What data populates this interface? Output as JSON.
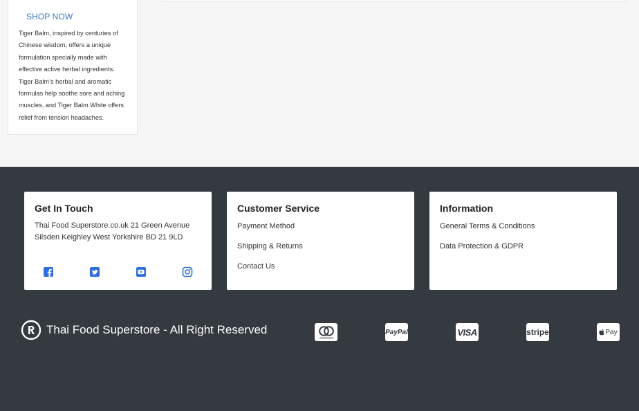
{
  "promo": {
    "shop_now": "SHOP NOW",
    "description": "Tiger Balm, inspired by centuries of Chinese wisdom, offers a unique formulation specially made with effective active herbal ingredients. Tiger Balm’s herbal and aromatic formulas help soothe sore and aching muscles, and Tiger Balm White offers relief from tension headaches."
  },
  "footer": {
    "contact": {
      "title": "Get In Touch",
      "address": "Thai Food Superstore.co.uk 21 Green Avenue Silsden Keighley West Yorkshire BD 21 9LD",
      "social": [
        "facebook-icon",
        "twitter-icon",
        "youtube-icon",
        "instagram-icon"
      ]
    },
    "customer_service": {
      "title": "Customer Service",
      "links": [
        "Payment Method",
        "Shipping & Returns",
        "Contact Us"
      ]
    },
    "information": {
      "title": "Information",
      "links": [
        "General Terms & Conditions",
        "Data Protection & GDPR"
      ]
    },
    "copyright": "Thai Food Superstore - All Right Reserved",
    "payments": {
      "mastercard_label": "mastercard",
      "paypal_label": "PayPal",
      "visa_label": "VISA",
      "stripe_label": "stripe",
      "applepay_label": "Pay"
    }
  },
  "colors": {
    "footer_bg": "#343a40",
    "link_accent": "#3a78c2",
    "social_blue": "#2f6fdc"
  }
}
